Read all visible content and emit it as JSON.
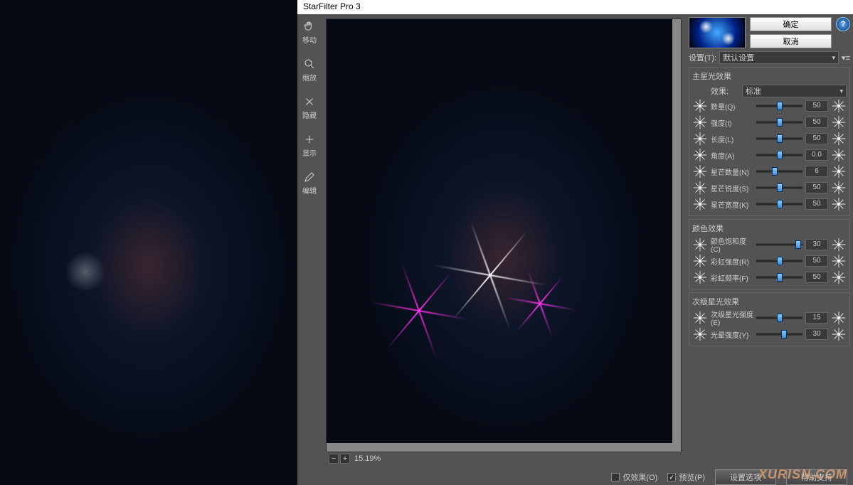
{
  "title": "StarFilter Pro 3",
  "watermark": "XURISN.COM",
  "tools": [
    {
      "name": "move",
      "label": "移动"
    },
    {
      "name": "zoom",
      "label": "缩放"
    },
    {
      "name": "hide",
      "label": "隐藏"
    },
    {
      "name": "show",
      "label": "显示"
    },
    {
      "name": "edit",
      "label": "编辑"
    }
  ],
  "zoom": "15.19%",
  "buttons": {
    "ok": "确定",
    "cancel": "取消"
  },
  "settings": {
    "label": "设置(T):",
    "value": "默认设置"
  },
  "groups": {
    "main": {
      "title": "主星光效果",
      "effect": {
        "label": "效果:",
        "value": "标准"
      },
      "sliders": [
        {
          "label": "数量(Q)",
          "val": "50",
          "pos": 50
        },
        {
          "label": "强度(I)",
          "val": "50",
          "pos": 50
        },
        {
          "label": "长度(L)",
          "val": "50",
          "pos": 50
        },
        {
          "label": "角度(A)",
          "val": "0.0",
          "pos": 50
        },
        {
          "label": "星芒数量(N)",
          "val": "6",
          "pos": 40
        },
        {
          "label": "星芒锐度(S)",
          "val": "50",
          "pos": 50
        },
        {
          "label": "星芒宽度(K)",
          "val": "50",
          "pos": 50
        }
      ]
    },
    "color": {
      "title": "颜色效果",
      "sliders": [
        {
          "label": "颜色饱和度(C)",
          "val": "30",
          "pos": 90
        },
        {
          "label": "彩虹强度(R)",
          "val": "50",
          "pos": 50
        },
        {
          "label": "彩虹频率(F)",
          "val": "50",
          "pos": 50
        }
      ]
    },
    "sec": {
      "title": "次级星光效果",
      "sliders": [
        {
          "label": "次级星光强度(E)",
          "val": "15",
          "pos": 50
        },
        {
          "label": "光晕强度(Y)",
          "val": "30",
          "pos": 60
        }
      ]
    }
  },
  "footer": {
    "effectonly": "仅效果(O)",
    "preview": "预览(P)",
    "options": "设置选项",
    "help": "帮助支持"
  }
}
